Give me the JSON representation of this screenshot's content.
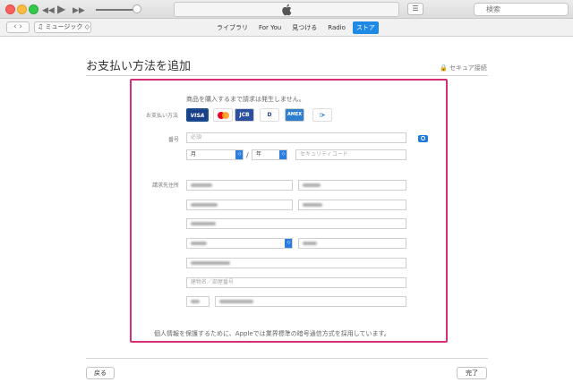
{
  "titlebar": {
    "controls": {
      "rewind": "◀◀",
      "play": "▶",
      "forward": "▶▶"
    },
    "apple_logo": "",
    "search_placeholder": "検索"
  },
  "navbar": {
    "back_forward": "‹ ›",
    "media_selector": "♫ ミュージック ◇",
    "tabs": [
      {
        "label": "ライブラリ",
        "active": false
      },
      {
        "label": "For You",
        "active": false
      },
      {
        "label": "見つける",
        "active": false
      },
      {
        "label": "Radio",
        "active": false
      },
      {
        "label": "ストア",
        "active": true
      }
    ]
  },
  "page": {
    "title": "お支払い方法を追加",
    "secure_label": "🔒 セキュア接続",
    "notice": "商品を購入するまで請求は発生しません。",
    "payment_label": "お支払い方法",
    "cards": [
      "VISA",
      "MasterCard",
      "JCB",
      "Diners",
      "AMEX",
      "other"
    ],
    "card_text": {
      "visa": "VISA",
      "jcb": "JCB",
      "diners": "D",
      "amex": "AMEX",
      "other": "▯▸"
    },
    "number_label": "番号",
    "number_placeholder": "必須",
    "month_value": "月",
    "year_value": "年",
    "slash": "/",
    "security_code_placeholder": "セキュリティコード",
    "billing_label": "請求先住所",
    "building_placeholder": "建物名／部屋番号",
    "footnote": "個人情報を保護するために、Appleでは業界標準の暗号通信方式を採用しています。",
    "back_button": "戻る",
    "done_button": "完了"
  },
  "colors": {
    "accent": "#1f8ae6",
    "highlight_border": "#d43077"
  }
}
